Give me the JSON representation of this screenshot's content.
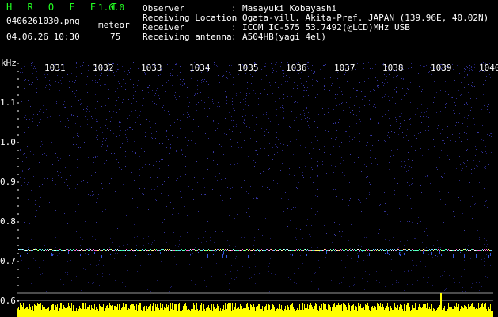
{
  "app": {
    "title": "H R O F F T",
    "version": "1.0.0"
  },
  "file": {
    "name": "0406261030.png",
    "datetime": "04.06.26 10:30"
  },
  "meteor": {
    "label": "meteor",
    "count": "75"
  },
  "info": [
    {
      "label": "Observer",
      "value": "Masayuki Kobayashi"
    },
    {
      "label": "Receiving Location",
      "value": "Ogata-vill. Akita-Pref. JAPAN (139.96E, 40.02N)"
    },
    {
      "label": "Receiver",
      "value": "ICOM IC-575 53.7492(@LCD)MHz USB"
    },
    {
      "label": "Receiving antenna",
      "value": "A504HB(yagi 4el)"
    }
  ],
  "axis": {
    "y_unit": "kHz",
    "y_ticks": [
      "1.1",
      "1.0",
      "0.9",
      "0.8",
      "0.7",
      "0.6"
    ],
    "x_ticks": [
      "1031",
      "1032",
      "1033",
      "1034",
      "1035",
      "1036",
      "1037",
      "1038",
      "1039",
      "1040"
    ]
  },
  "colors": {
    "title": "#22ff22",
    "signal": "#66ffcc",
    "activity": "#ffff00",
    "noise": "#2a2a88"
  }
}
